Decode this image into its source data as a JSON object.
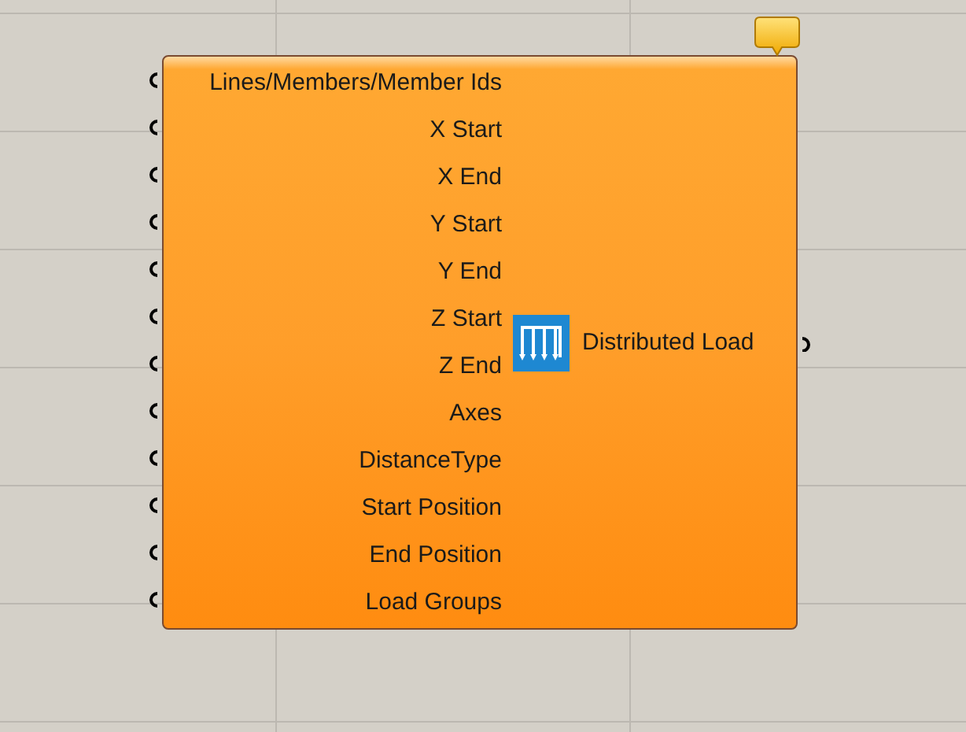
{
  "component": {
    "inputs": [
      "Lines/Members/Member Ids",
      "X Start",
      "X End",
      "Y Start",
      "Y End",
      "Z Start",
      "Z End",
      "Axes",
      "DistanceType",
      "Start Position",
      "End Position",
      "Load Groups"
    ],
    "outputs": [
      "Distributed Load"
    ]
  }
}
